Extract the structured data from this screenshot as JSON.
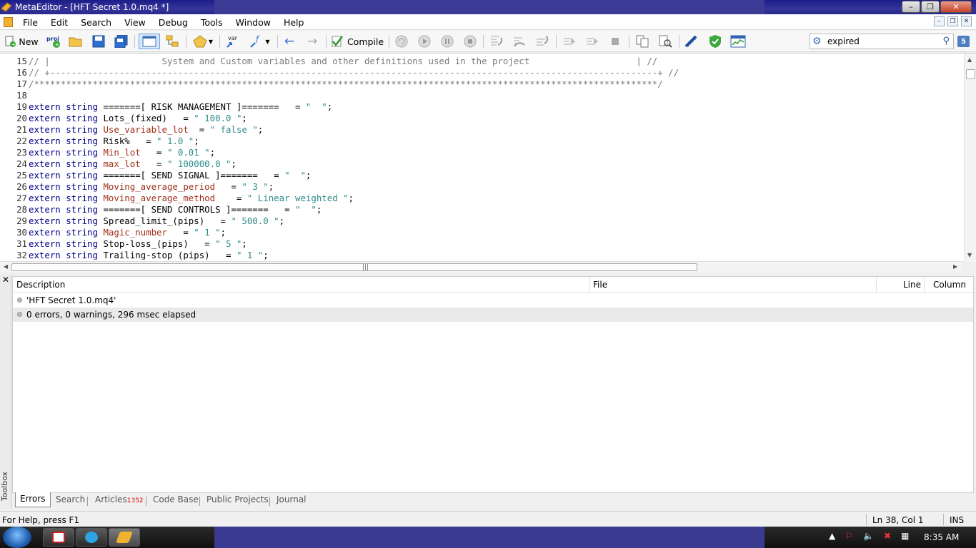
{
  "window": {
    "title": "MetaEditor - [HFT Secret 1.0.mq4 *]"
  },
  "menu": [
    "File",
    "Edit",
    "Search",
    "View",
    "Debug",
    "Tools",
    "Window",
    "Help"
  ],
  "toolbar": {
    "new_label": "New",
    "compile_label": "Compile",
    "proj_label": "proj",
    "var_label": "var",
    "search_value": "expired",
    "search_count": "5"
  },
  "editor": {
    "lines": [
      {
        "n": "15",
        "parts": [
          {
            "t": "// |                     System and Custom variables and other definitions used in the project                    | //",
            "c": "cm"
          }
        ]
      },
      {
        "n": "16",
        "parts": [
          {
            "t": "// +------------------------------------------------------------------------------------------------------------------+ //",
            "c": "cm"
          }
        ]
      },
      {
        "n": "17",
        "parts": [
          {
            "t": "/*********************************************************************************************************************/",
            "c": "cm"
          }
        ]
      },
      {
        "n": "18",
        "parts": [
          {
            "t": "",
            "c": "plain"
          }
        ]
      },
      {
        "n": "19",
        "parts": [
          {
            "t": "extern string ",
            "c": "kw"
          },
          {
            "t": "=======[ RISK MANAGEMENT ]=======   = ",
            "c": "plain"
          },
          {
            "t": "\"  \"",
            "c": "str"
          },
          {
            "t": ";",
            "c": "plain"
          }
        ]
      },
      {
        "n": "20",
        "parts": [
          {
            "t": "extern string ",
            "c": "kw"
          },
          {
            "t": "Lots_(fixed)   = ",
            "c": "plain"
          },
          {
            "t": "\" 100.0 \"",
            "c": "str"
          },
          {
            "t": ";",
            "c": "plain"
          }
        ]
      },
      {
        "n": "21",
        "parts": [
          {
            "t": "extern string ",
            "c": "kw"
          },
          {
            "t": "Use_variable_lot",
            "c": "var"
          },
          {
            "t": "  = ",
            "c": "plain"
          },
          {
            "t": "\" false \"",
            "c": "str"
          },
          {
            "t": ";",
            "c": "plain"
          }
        ]
      },
      {
        "n": "22",
        "parts": [
          {
            "t": "extern string ",
            "c": "kw"
          },
          {
            "t": "Risk%   = ",
            "c": "plain"
          },
          {
            "t": "\" 1.0 \"",
            "c": "str"
          },
          {
            "t": ";",
            "c": "plain"
          }
        ]
      },
      {
        "n": "23",
        "parts": [
          {
            "t": "extern string ",
            "c": "kw"
          },
          {
            "t": "Min_lot",
            "c": "var"
          },
          {
            "t": "   = ",
            "c": "plain"
          },
          {
            "t": "\" 0.01 \"",
            "c": "str"
          },
          {
            "t": ";",
            "c": "plain"
          }
        ]
      },
      {
        "n": "24",
        "parts": [
          {
            "t": "extern string ",
            "c": "kw"
          },
          {
            "t": "max_lot",
            "c": "var"
          },
          {
            "t": "   = ",
            "c": "plain"
          },
          {
            "t": "\" 100000.0 \"",
            "c": "str"
          },
          {
            "t": ";",
            "c": "plain"
          }
        ]
      },
      {
        "n": "25",
        "parts": [
          {
            "t": "extern string ",
            "c": "kw"
          },
          {
            "t": "=======[ SEND SIGNAL ]=======   = ",
            "c": "plain"
          },
          {
            "t": "\"  \"",
            "c": "str"
          },
          {
            "t": ";",
            "c": "plain"
          }
        ]
      },
      {
        "n": "26",
        "parts": [
          {
            "t": "extern string ",
            "c": "kw"
          },
          {
            "t": "Moving_average_period",
            "c": "var"
          },
          {
            "t": "   = ",
            "c": "plain"
          },
          {
            "t": "\" 3 \"",
            "c": "str"
          },
          {
            "t": ";",
            "c": "plain"
          }
        ]
      },
      {
        "n": "27",
        "parts": [
          {
            "t": "extern string ",
            "c": "kw"
          },
          {
            "t": "Moving_average_method",
            "c": "var"
          },
          {
            "t": "    = ",
            "c": "plain"
          },
          {
            "t": "\" Linear weighted \"",
            "c": "str"
          },
          {
            "t": ";",
            "c": "plain"
          }
        ]
      },
      {
        "n": "28",
        "parts": [
          {
            "t": "extern string ",
            "c": "kw"
          },
          {
            "t": "=======[ SEND CONTROLS ]=======   = ",
            "c": "plain"
          },
          {
            "t": "\"  \"",
            "c": "str"
          },
          {
            "t": ";",
            "c": "plain"
          }
        ]
      },
      {
        "n": "29",
        "parts": [
          {
            "t": "extern string ",
            "c": "kw"
          },
          {
            "t": "Spread_limit_(pips)   = ",
            "c": "plain"
          },
          {
            "t": "\" 500.0 \"",
            "c": "str"
          },
          {
            "t": ";",
            "c": "plain"
          }
        ]
      },
      {
        "n": "30",
        "parts": [
          {
            "t": "extern string ",
            "c": "kw"
          },
          {
            "t": "Magic_number",
            "c": "var"
          },
          {
            "t": "   = ",
            "c": "plain"
          },
          {
            "t": "\" 1 \"",
            "c": "str"
          },
          {
            "t": ";",
            "c": "plain"
          }
        ]
      },
      {
        "n": "31",
        "parts": [
          {
            "t": "extern string ",
            "c": "kw"
          },
          {
            "t": "Stop-loss_(pips)   = ",
            "c": "plain"
          },
          {
            "t": "\" 5 \"",
            "c": "str"
          },
          {
            "t": ";",
            "c": "plain"
          }
        ]
      },
      {
        "n": "32",
        "parts": [
          {
            "t": "extern string ",
            "c": "kw"
          },
          {
            "t": "Trailing-stop (pips)   = ",
            "c": "plain"
          },
          {
            "t": "\" 1 \"",
            "c": "str"
          },
          {
            "t": ";",
            "c": "plain"
          }
        ]
      }
    ]
  },
  "toolbox": {
    "label": "Toolbox",
    "columns": {
      "description": "Description",
      "file": "File",
      "line": "Line",
      "column": "Column"
    },
    "rows": [
      {
        "description": "'HFT Secret 1.0.mq4'"
      },
      {
        "description": "0 errors, 0 warnings, 296 msec elapsed"
      }
    ],
    "tabs": {
      "errors": "Errors",
      "search": "Search",
      "articles": "Articles",
      "articles_count": "1352",
      "codebase": "Code Base",
      "public": "Public Projects",
      "journal": "Journal"
    }
  },
  "status": {
    "help": "For Help, press F1",
    "position": "Ln 38, Col 1",
    "mode": "INS"
  },
  "taskbar": {
    "time": "8:35 AM"
  },
  "colors": {
    "keyword": "#00008b",
    "comment": "#7a7a7a",
    "string": "#2d8a8a",
    "variable": "#a0301a"
  }
}
